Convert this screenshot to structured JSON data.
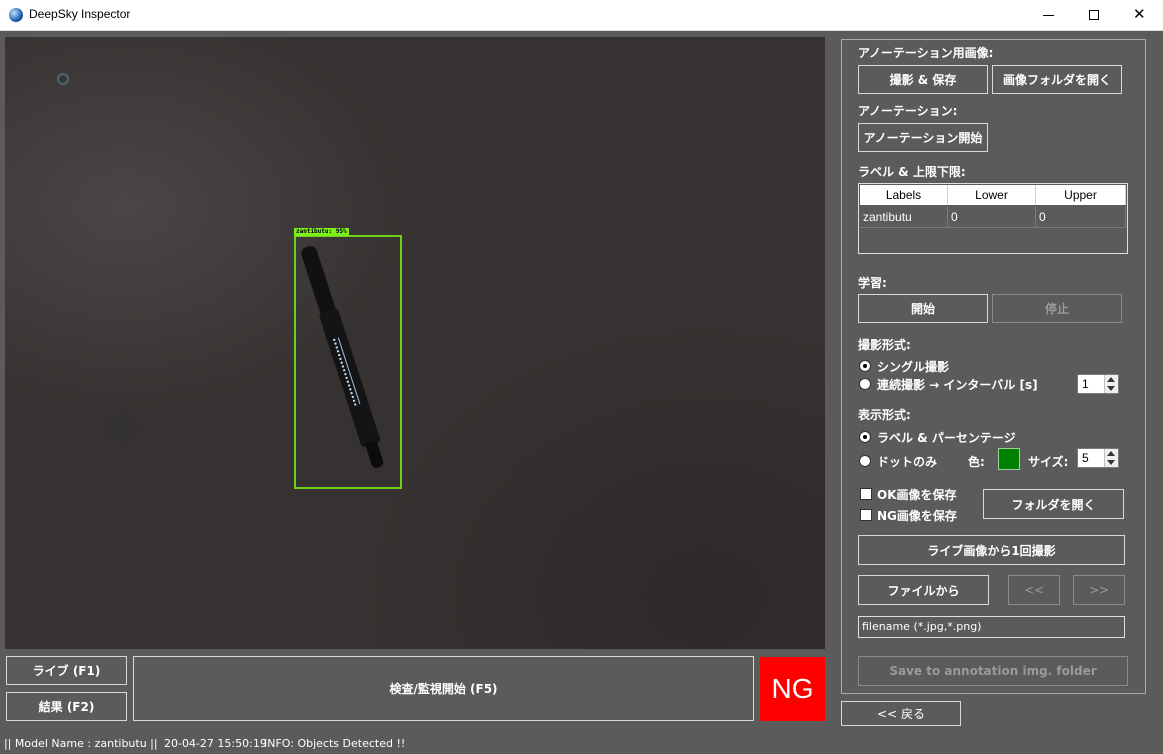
{
  "window": {
    "title": "DeepSky Inspector",
    "minimize_symbol": "—",
    "maximize_symbol": "☐",
    "close_symbol": "✕"
  },
  "viewer": {
    "detection_label": "zantibutu: 95%"
  },
  "bottom": {
    "live_button": "ライブ (F1)",
    "result_button": "結果 (F2)",
    "inspect_button": "検査/監視開始 (F5)",
    "verdict": "NG"
  },
  "panel": {
    "annot_image_heading": "アノーテーション用画像:",
    "capture_save_button": "撮影 & 保存",
    "open_image_folder_button": "画像フォルダを開く",
    "annotation_heading": "アノーテーション:",
    "start_annotation_button": "アノーテーション開始",
    "labels_heading": "ラベル & 上限下限:",
    "table": {
      "columns": [
        "Labels",
        "Lower",
        "Upper"
      ],
      "rows": [
        [
          "zantibutu",
          "0",
          "0"
        ]
      ]
    },
    "training_heading": "学習:",
    "train_start_button": "開始",
    "train_stop_button": "停止",
    "capture_mode_heading": "撮影形式:",
    "single_capture_option": "シングル撮影",
    "continuous_capture_option": "連続撮影 → インターバル [s]",
    "interval_value": "1",
    "display_mode_heading": "表示形式:",
    "label_percent_option": "ラベル & パーセンテージ",
    "dots_only_option": "ドットのみ",
    "color_label": "色:",
    "dot_color": "#008000",
    "size_label": "サイズ:",
    "size_value": "5",
    "save_ok_option": "OK画像を保存",
    "save_ng_option": "NG画像を保存",
    "open_folder_button": "フォルダを開く",
    "capture_once_button": "ライブ画像から1回撮影",
    "from_file_button": "ファイルから",
    "prev_button": "<<",
    "next_button": ">>",
    "filename_value": "filename (*.jpg,*.png)",
    "save_annotation_button": "Save to annotation img. folder"
  },
  "back_button": "<< 戻る",
  "status": {
    "model": "|| Model Name : zantibutu ||",
    "timestamp": "20-04-27 15:50:19",
    "info": "INFO:  Objects Detected !!"
  },
  "colors": {
    "background": "#5b5b5b",
    "ng_badge": "#ff0000",
    "detection_box": "#6fd11a"
  }
}
